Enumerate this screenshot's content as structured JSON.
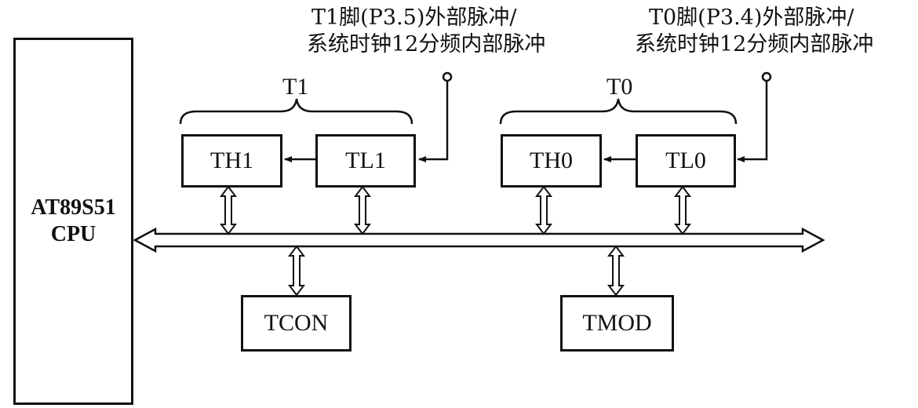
{
  "cpu": {
    "line1": "AT89S51",
    "line2": "CPU"
  },
  "timer1": {
    "group_label": "T1",
    "high_register": "TH1",
    "low_register": "TL1",
    "source_line1": "T1脚(P3.5)外部脉冲/",
    "source_line2": "系统时钟12分频内部脉冲"
  },
  "timer0": {
    "group_label": "T0",
    "high_register": "TH0",
    "low_register": "TL0",
    "source_line1": "T0脚(P3.4)外部脉冲/",
    "source_line2": "系统时钟12分频内部脉冲"
  },
  "control": {
    "tcon": "TCON",
    "tmod": "TMOD"
  }
}
